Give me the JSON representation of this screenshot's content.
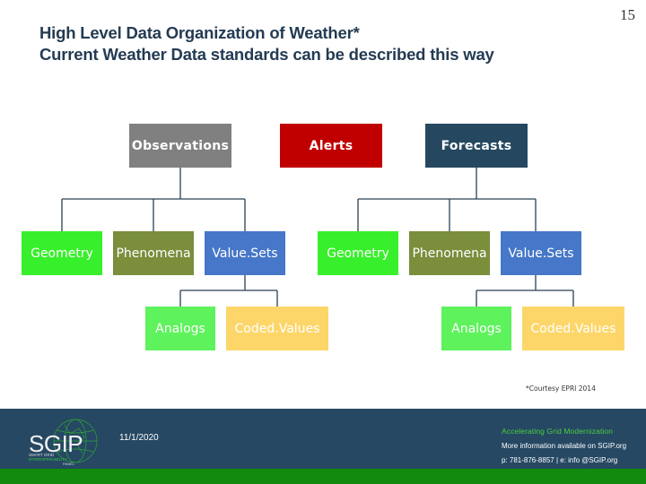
{
  "slide": {
    "page_number": "15",
    "title_line1": "High Level Data Organization of Weather*",
    "title_line2": "Current Weather Data standards can be described this way",
    "footnote": "*Courtesy EPRI 2014"
  },
  "diagram": {
    "top_nodes": [
      {
        "label": "Observations",
        "color": "#808080"
      },
      {
        "label": "Alerts",
        "color": "#c00000"
      },
      {
        "label": "Forecasts",
        "color": "#254860"
      }
    ],
    "observations_children": [
      {
        "label": "Geometry",
        "color": "#38ef2b"
      },
      {
        "label": "Phenomena",
        "color": "#7a8e3c"
      },
      {
        "label": "Value.Sets",
        "color": "#4677c8"
      }
    ],
    "observations_valuesets_children": [
      {
        "label": "Analogs",
        "color": "#5ef25c"
      },
      {
        "label": "Coded.Values",
        "color": "#fdd66a"
      }
    ],
    "forecasts_children": [
      {
        "label": "Geometry",
        "color": "#38ef2b"
      },
      {
        "label": "Phenomena",
        "color": "#7a8e3c"
      },
      {
        "label": "Value.Sets",
        "color": "#4677c8"
      }
    ],
    "forecasts_valuesets_children": [
      {
        "label": "Analogs",
        "color": "#5ef25c"
      },
      {
        "label": "Coded.Values",
        "color": "#fdd66a"
      }
    ],
    "connector_color": "#2b4050"
  },
  "footer": {
    "logo_text": "SGIP",
    "logo_sub1": "SMART GRID",
    "logo_sub2": "INTEROPERABILITY",
    "logo_sub3": "PANEL",
    "date": "11/1/2020",
    "tagline": "Accelerating Grid Modernization",
    "info_line1": "More information available on SGIP.org",
    "info_line2": "p: 781-876-8857  |  e: info @SGIP.org"
  }
}
